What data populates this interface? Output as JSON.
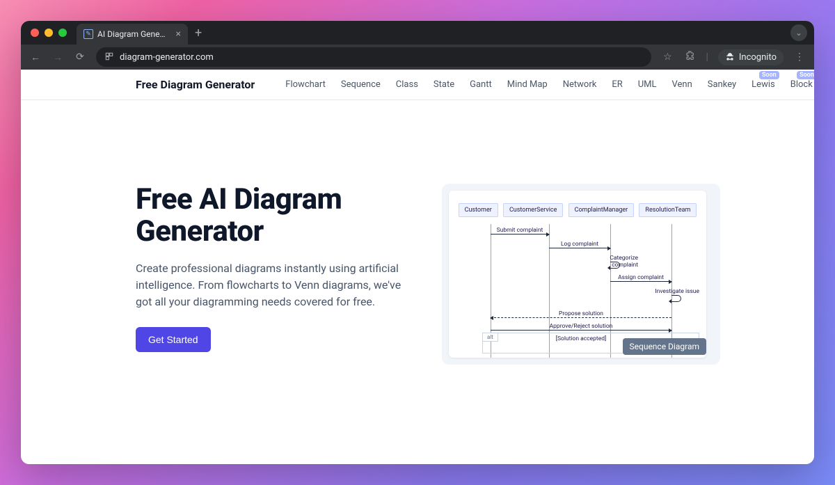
{
  "browser": {
    "tab_title": "AI Diagram Generator | Create",
    "url": "diagram-generator.com",
    "incognito_label": "Incognito"
  },
  "nav": {
    "brand": "Free Diagram Generator",
    "items": [
      {
        "label": "Flowchart"
      },
      {
        "label": "Sequence"
      },
      {
        "label": "Class"
      },
      {
        "label": "State"
      },
      {
        "label": "Gantt"
      },
      {
        "label": "Mind Map"
      },
      {
        "label": "Network"
      },
      {
        "label": "ER"
      },
      {
        "label": "UML"
      },
      {
        "label": "Venn"
      },
      {
        "label": "Sankey"
      },
      {
        "label": "Lewis",
        "badge": "Soon"
      },
      {
        "label": "Block",
        "badge": "Soon"
      }
    ]
  },
  "hero": {
    "title": "Free AI Diagram Generator",
    "subtitle": "Create professional diagrams instantly using artificial intelligence. From flowcharts to Venn diagrams, we've got all your diagramming needs covered for free.",
    "cta": "Get Started"
  },
  "preview": {
    "caption": "Sequence Diagram",
    "actors": [
      "Customer",
      "CustomerService",
      "ComplaintManager",
      "ResolutionTeam"
    ],
    "messages": {
      "m1": "Submit complaint",
      "m2": "Log complaint",
      "m3": "Categorize complaint",
      "m4": "Assign complaint",
      "m5": "Investigate issue",
      "m6": "Propose solution",
      "m7": "Approve/Reject solution",
      "m8": "[Solution accepted]"
    },
    "alt": "alt"
  }
}
